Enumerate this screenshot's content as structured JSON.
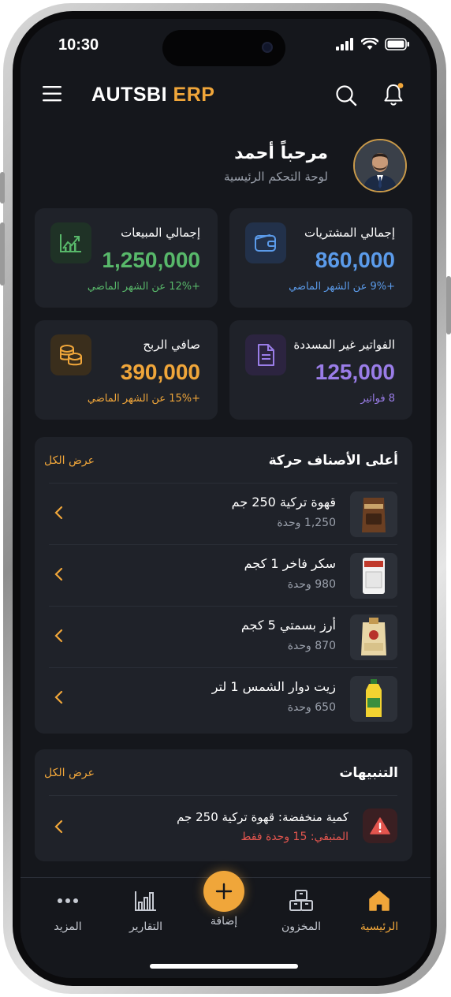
{
  "status_bar": {
    "time": "10:30"
  },
  "header": {
    "brand_main": "AUTSBI",
    "brand_accent": "ERP"
  },
  "greeting": {
    "title": "مرحباً أحمد",
    "subtitle": "لوحة التحكم الرئيسية"
  },
  "stats": [
    {
      "label": "إجمالي المشتريات",
      "value": "860,000",
      "note": "+9% عن الشهر الماضي",
      "color": "#5b9bea",
      "icon": "wallet-icon"
    },
    {
      "label": "إجمالي المبيعات",
      "value": "1,250,000",
      "note": "+12% عن الشهر الماضي",
      "color": "#58b86a",
      "icon": "chart-up-icon"
    },
    {
      "label": "الفواتير غير المسددة",
      "value": "125,000",
      "note": "8 فواتير",
      "color": "#9a7de8",
      "icon": "document-icon"
    },
    {
      "label": "صافي الربح",
      "value": "390,000",
      "note": "+15% عن الشهر الماضي",
      "color": "#f0a63a",
      "icon": "coins-icon"
    }
  ],
  "top_items": {
    "title": "أعلى الأصناف حركة",
    "view_all": "عرض الكل",
    "items": [
      {
        "name": "قهوة تركية 250 جم",
        "qty": "1,250 وحدة"
      },
      {
        "name": "سكر فاخر 1 كجم",
        "qty": "980 وحدة"
      },
      {
        "name": "أرز بسمتي 5 كجم",
        "qty": "870 وحدة"
      },
      {
        "name": "زيت دوار الشمس 1 لتر",
        "qty": "650 وحدة"
      }
    ]
  },
  "alerts": {
    "title": "التنبيهات",
    "view_all": "عرض الكل",
    "items": [
      {
        "title": "كمية منخفضة: قهوة تركية 250 جم",
        "subtitle": "المتبقي: 15 وحدة فقط"
      }
    ]
  },
  "tabbar": {
    "home": "الرئيسية",
    "inventory": "المخزون",
    "add": "إضافة",
    "reports": "التقارير",
    "more": "المزيد",
    "active": "home",
    "accent": "#f0a63a"
  }
}
